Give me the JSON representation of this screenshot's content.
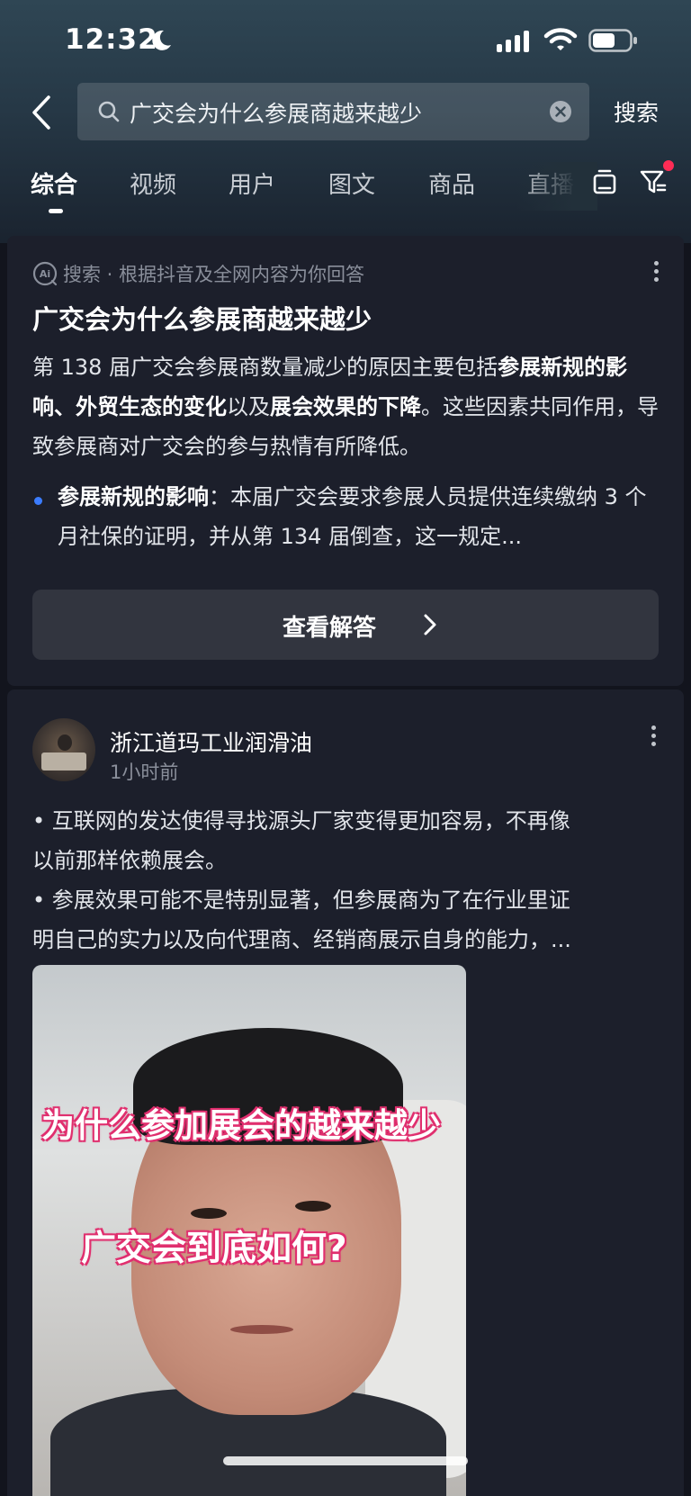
{
  "status_bar": {
    "time": "12:32",
    "moon_icon": "moon-icon",
    "signal_icon": "cellular-signal-icon",
    "wifi_icon": "wifi-icon",
    "battery_icon": "battery-icon"
  },
  "search": {
    "query": "广交会为什么参展商越来越少",
    "button_label": "搜索",
    "back_icon": "back-chevron-icon",
    "search_icon": "search-icon",
    "clear_icon": "clear-icon"
  },
  "tabs": {
    "items": [
      {
        "label": "综合",
        "active": true
      },
      {
        "label": "视频",
        "active": false
      },
      {
        "label": "用户",
        "active": false
      },
      {
        "label": "图文",
        "active": false
      },
      {
        "label": "商品",
        "active": false
      },
      {
        "label": "直播",
        "active": false
      }
    ],
    "icons": [
      "tv-icon",
      "filter-icon"
    ]
  },
  "ai_answer": {
    "source": "搜索 · 根据抖音及全网内容为你回答",
    "title": "广交会为什么参展商越来越少",
    "summary_1": "第 138 届广交会参展商数量减少的原因主要包括",
    "summary_bold_1": "参展新规的影响",
    "summary_2": "、",
    "summary_bold_2": "外贸生态的变化",
    "summary_3": "以及",
    "summary_bold_3": "展会效果的下降",
    "summary_4": "。这些因素共同作用，导致参展商对广交会的参与热情有所降低。",
    "bullet_title": "参展新规的影响",
    "bullet_text": "：本届广交会要求参展人员提供连续缴纳 3 个月社保的证明，并从第 134 届倒查，这一规定...",
    "view_button": "查看解答",
    "accent": "#3b7cff"
  },
  "post": {
    "author": "浙江道玛工业润滑油",
    "time_ago": "1小时前",
    "line_1": "• 互联网的发达使得寻找源头厂家变得更加容易，不再像",
    "line_2": "以前那样依赖展会。",
    "line_3": "• 参展效果可能不是特别显著，但参展商为了在行业里证",
    "line_4": "明自己的实力以及向代理商、经销商展示自身的能力，...",
    "video_caption_1": "为什么参加展会的越来越少",
    "video_caption_2": "广交会到底如何?",
    "caption_color": "#e0306f"
  }
}
